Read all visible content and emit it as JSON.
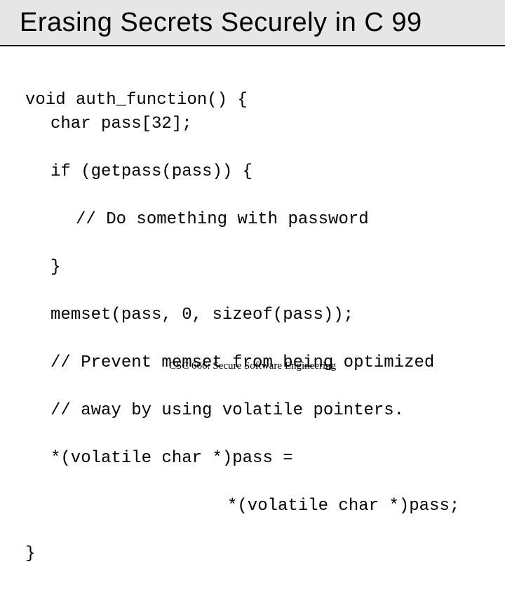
{
  "title": "Erasing Secrets Securely in C 99",
  "code": {
    "l1": "void auth_function() {",
    "l2": "char pass[32];",
    "l3": "if (getpass(pass)) {",
    "l4": "// Do something with password",
    "l5": "}",
    "l6": "memset(pass, 0, sizeof(pass));",
    "l7": "// Prevent memset from being optimized",
    "l8": "// away by using volatile pointers.",
    "l9": "*(volatile char *)pass =",
    "l10": "*(volatile char *)pass;",
    "l11": "}"
  },
  "footer": "CSC 666: Secure Software Engineering"
}
